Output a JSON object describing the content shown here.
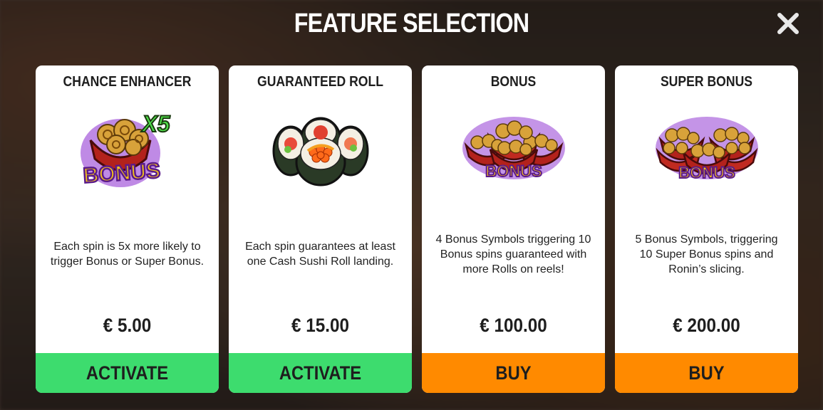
{
  "title": "FEATURE SELECTION",
  "close_icon": "close-icon",
  "colors": {
    "activate": "#3ddc6e",
    "buy": "#ff8a00"
  },
  "cards": [
    {
      "title": "CHANCE ENHANCER",
      "icon": "bonus-x5-icon",
      "badge": "X5",
      "image_text": "BONUS",
      "description": "Each spin is 5x more likely to trigger Bonus or Super Bonus.",
      "price": "€ 5.00",
      "button": "ACTIVATE"
    },
    {
      "title": "GUARANTEED ROLL",
      "icon": "sushi-roll-icon",
      "description": "Each spin guarantees at least one Cash Sushi Roll landing.",
      "price": "€ 15.00",
      "button": "ACTIVATE"
    },
    {
      "title": "BONUS",
      "icon": "bonus-bowls-icon",
      "image_text": "BONUS",
      "description": "4 Bonus Symbols triggering 10 Bonus spins guaranteed with more Rolls on reels!",
      "price": "€ 100.00",
      "button": "BUY"
    },
    {
      "title": "SUPER BONUS",
      "icon": "super-bonus-bowls-icon",
      "image_text": "BONUS",
      "description": "5 Bonus Symbols, triggering 10 Super Bonus spins and Ronin’s slicing.",
      "price": "€ 200.00",
      "button": "BUY"
    }
  ]
}
